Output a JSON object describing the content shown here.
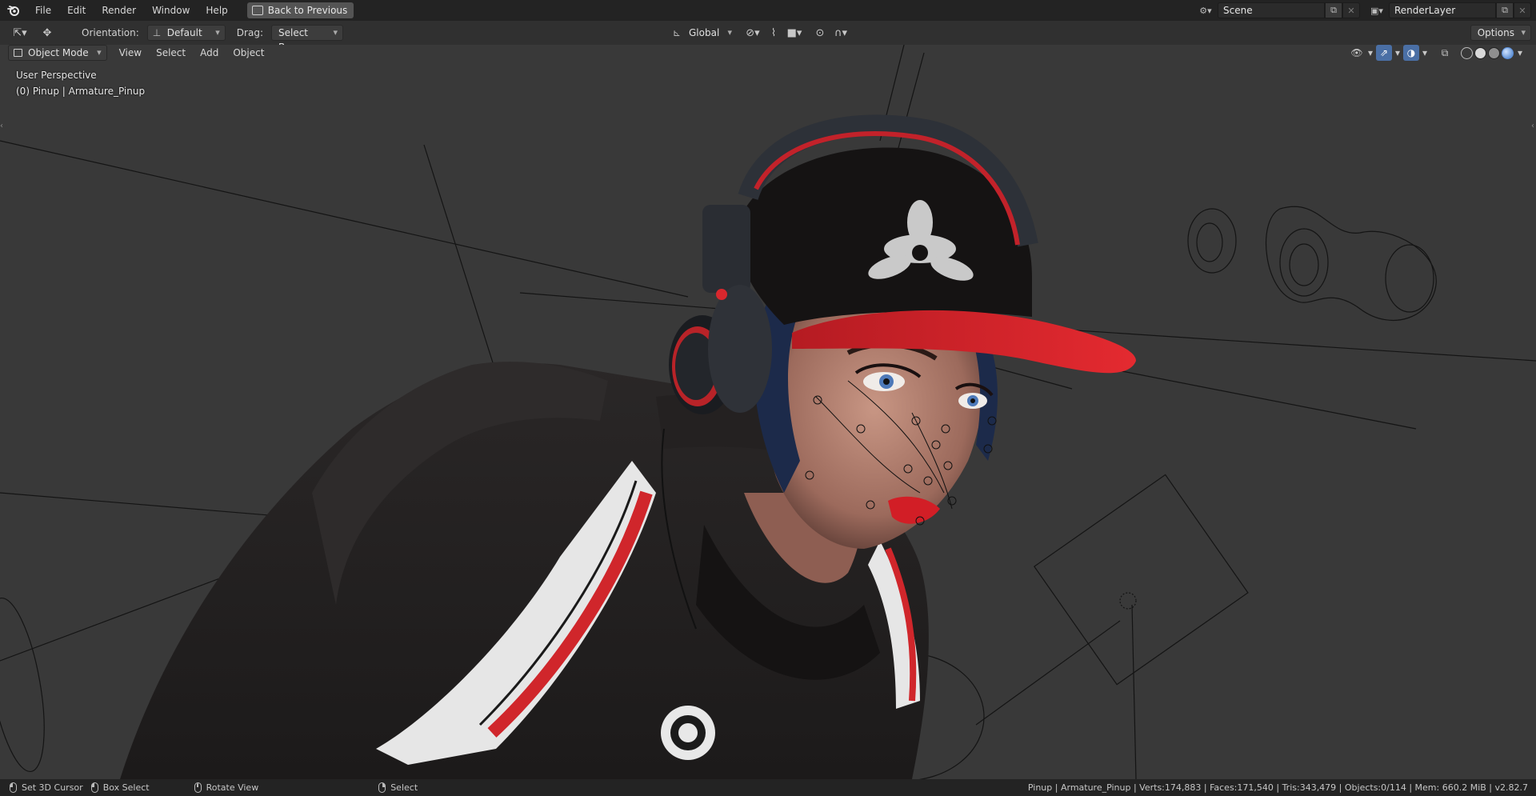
{
  "menubar": {
    "items": [
      "File",
      "Edit",
      "Render",
      "Window",
      "Help"
    ],
    "back_button": "Back to Previous",
    "scene_name": "Scene",
    "render_layer": "RenderLayer"
  },
  "toolheader": {
    "orientation_label": "Orientation:",
    "orientation_value": "Default",
    "drag_label": "Drag:",
    "drag_value": "Select Box",
    "transform_orientation": "Global",
    "options_label": "Options"
  },
  "viewport_header": {
    "mode": "Object Mode",
    "menus": [
      "View",
      "Select",
      "Add",
      "Object"
    ]
  },
  "viewport": {
    "perspective_label": "User Perspective",
    "object_label": "(0) Pinup | Armature_Pinup"
  },
  "statusbar": {
    "left_click": "Set 3D Cursor",
    "drag": "Box Select",
    "middle": "Rotate View",
    "right_click": "Select",
    "stats": "Pinup | Armature_Pinup | Verts:174,883 | Faces:171,540 | Tris:343,479 | Objects:0/114 | Mem: 660.2 MiB | v2.82.7"
  },
  "colors": {
    "viewport_bg": "#393939",
    "header_bg": "#303030",
    "topbar_bg": "#232323",
    "accent_blue": "#4a6fa5",
    "cap_red": "#e0262c"
  }
}
